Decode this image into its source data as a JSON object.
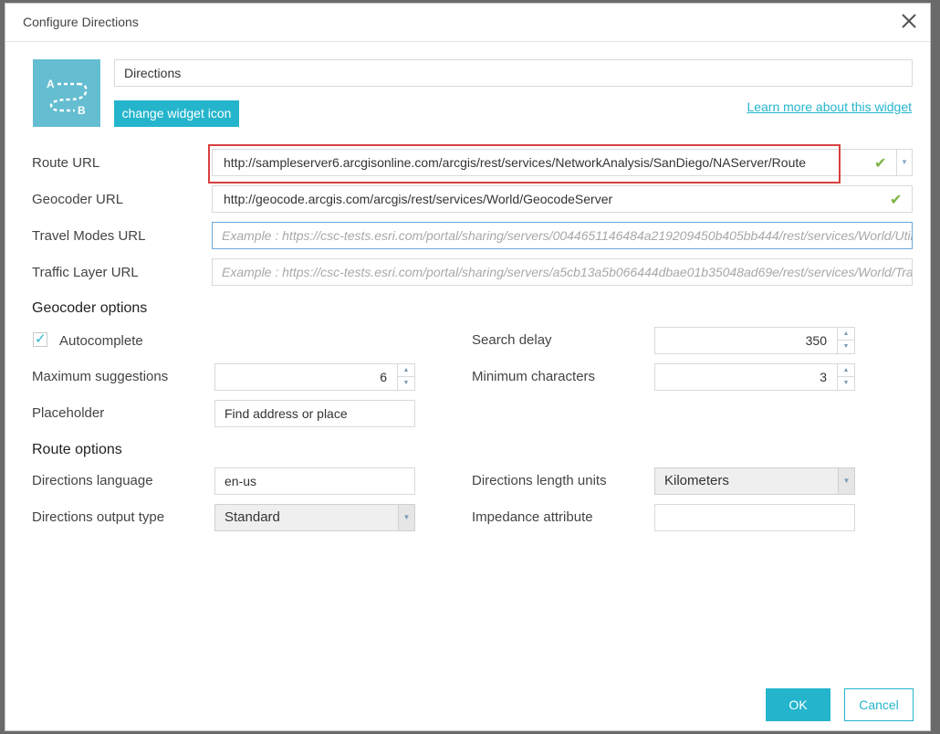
{
  "dialog": {
    "title": "Configure Directions",
    "close_icon": "close-icon"
  },
  "widget": {
    "icon": "directions-ab-icon",
    "icon_bg": "#64bdd0",
    "name_value": "Directions",
    "change_icon_label": "change widget icon",
    "learn_more_label": "Learn more about this widget"
  },
  "urls": {
    "route_label": "Route URL",
    "route_value": "http://sampleserver6.arcgisonline.com/arcgis/rest/services/NetworkAnalysis/SanDiego/NAServer/Route",
    "geocoder_label": "Geocoder URL",
    "geocoder_value": "http://geocode.arcgis.com/arcgis/rest/services/World/GeocodeServer",
    "travel_modes_label": "Travel Modes URL",
    "travel_modes_placeholder": "Example : https://csc-tests.esri.com/portal/sharing/servers/0044651146484a219209450b405bb444/rest/services/World/Utilities/GPServer",
    "traffic_label": "Traffic Layer URL",
    "traffic_placeholder": "Example : https://csc-tests.esri.com/portal/sharing/servers/a5cb13a5b066444dbae01b35048ad69e/rest/services/World/Traffic/MapServer"
  },
  "geocoder_options": {
    "heading": "Geocoder options",
    "autocomplete_label": "Autocomplete",
    "autocomplete_checked": true,
    "search_delay_label": "Search delay",
    "search_delay_value": "350",
    "max_suggestions_label": "Maximum suggestions",
    "max_suggestions_value": "6",
    "min_chars_label": "Minimum characters",
    "min_chars_value": "3",
    "placeholder_label": "Placeholder",
    "placeholder_value": "Find address or place"
  },
  "route_options": {
    "heading": "Route options",
    "language_label": "Directions language",
    "language_value": "en-us",
    "length_units_label": "Directions length units",
    "length_units_value": "Kilometers",
    "output_type_label": "Directions output type",
    "output_type_value": "Standard",
    "impedance_label": "Impedance attribute",
    "impedance_value": ""
  },
  "footer": {
    "ok_label": "OK",
    "cancel_label": "Cancel"
  },
  "colors": {
    "accent": "#24b5cc",
    "valid_check": "#7cb342",
    "highlight_box": "#d94040"
  }
}
